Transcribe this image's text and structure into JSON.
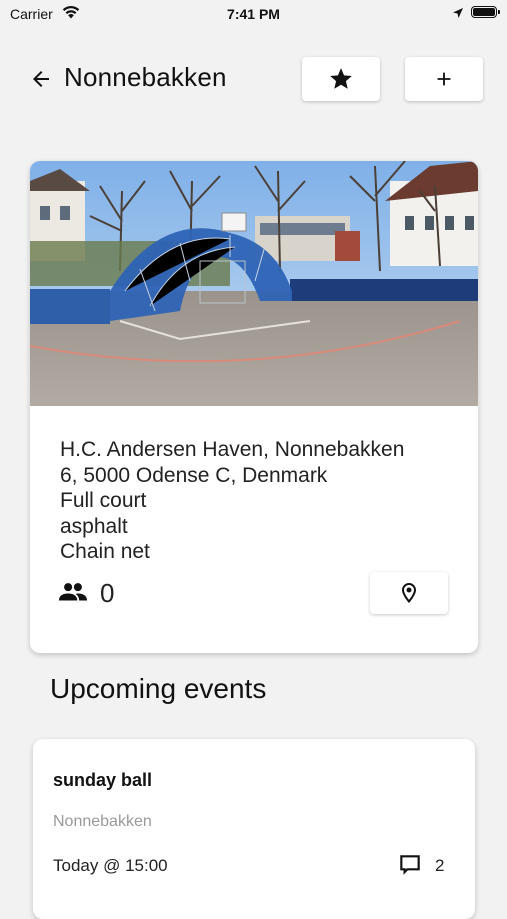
{
  "status_bar": {
    "carrier": "Carrier",
    "time": "7:41 PM"
  },
  "header": {
    "title": "Nonnebakken",
    "back_icon": "arrow-left-icon",
    "favorite_icon": "star-icon",
    "add_icon": "plus-icon"
  },
  "court": {
    "address_lines": [
      "H.C. Andersen Haven, Nonnebakken",
      "6, 5000 Odense C, Denmark"
    ],
    "court_type": "Full court",
    "surface": "asphalt",
    "net": "Chain net",
    "players_count": "0",
    "players_icon": "people-icon",
    "map_icon": "map-pin-icon"
  },
  "events_section": {
    "title": "Upcoming events"
  },
  "events": [
    {
      "name": "sunday ball",
      "location": "Nonnebakken",
      "time": "Today @ 15:00",
      "comments": "2"
    }
  ],
  "colors": {
    "background": "#f2f2f2",
    "card": "#ffffff",
    "muted_text": "#9a9a9a"
  }
}
